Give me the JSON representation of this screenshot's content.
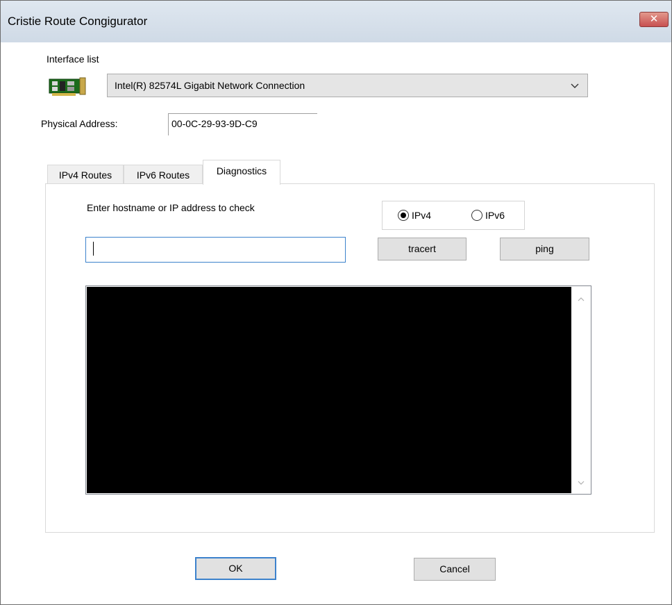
{
  "window": {
    "title": "Cristie Route Congigurator",
    "close_glyph": "✕"
  },
  "interface": {
    "label": "Interface list",
    "icon": "network-card-icon",
    "selected": "Intel(R) 82574L Gigabit Network Connection",
    "physical_address_label": "Physical Address:",
    "physical_address": "00-0C-29-93-9D-C9"
  },
  "tabs": [
    {
      "label": "IPv4 Routes",
      "active": false
    },
    {
      "label": "IPv6 Routes",
      "active": false
    },
    {
      "label": "Diagnostics",
      "active": true
    }
  ],
  "diagnostics": {
    "prompt": "Enter hostname or IP address to check",
    "host_value": "",
    "radio_ipv4": "IPv4",
    "radio_ipv6": "IPv6",
    "selected_protocol": "IPv4",
    "tracert_label": "tracert",
    "ping_label": "ping",
    "output_text": ""
  },
  "footer": {
    "ok_label": "OK",
    "cancel_label": "Cancel"
  },
  "colors": {
    "titlebar": "#d6e0eb",
    "close_button": "#c75050",
    "focus_border": "#3c82cc",
    "output_background": "#000000"
  }
}
